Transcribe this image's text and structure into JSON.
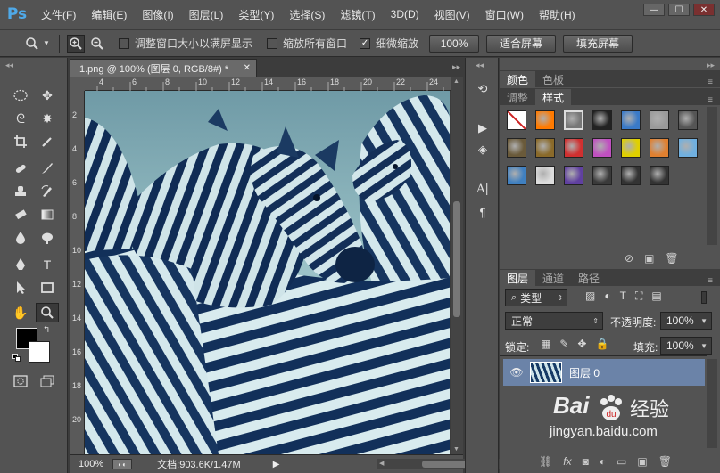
{
  "menubar": {
    "logo": "Ps",
    "items": [
      "文件(F)",
      "编辑(E)",
      "图像(I)",
      "图层(L)",
      "类型(Y)",
      "选择(S)",
      "滤镜(T)",
      "3D(D)",
      "视图(V)",
      "窗口(W)",
      "帮助(H)"
    ]
  },
  "optionsbar": {
    "resize_windows": "调整窗口大小以满屏显示",
    "zoom_all": "缩放所有窗口",
    "scrubby_zoom": "细微缩放",
    "zoom_100": "100%",
    "fit_screen": "适合屏幕",
    "fill_screen": "填充屏幕"
  },
  "document": {
    "tab_title": "1.png @ 100% (图层 0, RGB/8#) *",
    "ruler_h": [
      "4",
      "6",
      "8",
      "10",
      "12",
      "14",
      "16",
      "18",
      "20",
      "22",
      "24"
    ],
    "ruler_v": [
      "2",
      "4",
      "6",
      "8",
      "10",
      "12",
      "14",
      "16",
      "18",
      "20"
    ]
  },
  "statusbar": {
    "zoom": "100%",
    "doc_info": "文档:903.6K/1.47M"
  },
  "panels": {
    "color_tabs": [
      "颜色",
      "色板"
    ],
    "style_tabs": [
      "调整",
      "样式"
    ],
    "layer_tabs": [
      "图层",
      "通道",
      "路径"
    ],
    "filter_kind": "类型",
    "blend_mode": "正常",
    "opacity_label": "不透明度:",
    "opacity_value": "100%",
    "lock_label": "锁定:",
    "fill_label": "填充:",
    "fill_value": "100%",
    "layer_name": "图层 0"
  },
  "style_swatches": [
    "#c02020",
    "#ff7a00",
    "#777777",
    "#222222",
    "#3a7ac8",
    "#9a9a9a",
    "#555555",
    "#6a5a3a",
    "#8a6a2a",
    "#d03030",
    "#c050c0",
    "#e0d000",
    "#e08030",
    "#70b0e0",
    "#4080c0",
    "#dddddd",
    "#6040a0",
    "#3a3a3a",
    "#333333",
    "#333333"
  ],
  "watermark": {
    "brand": "Bai",
    "brand2": "经验",
    "url": "jingyan.baidu.com"
  }
}
